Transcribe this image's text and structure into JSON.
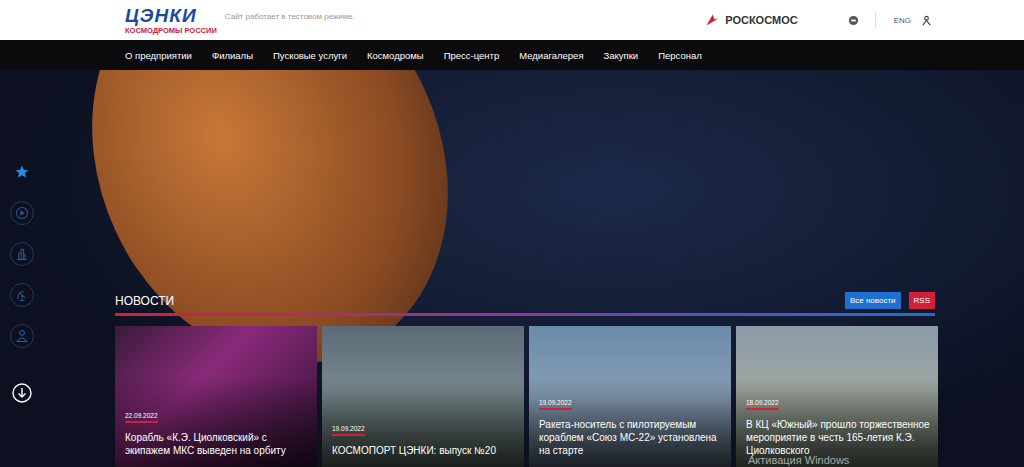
{
  "header": {
    "logo_title": "ЦЭНКИ",
    "logo_subtitle": "КОСМОДРОМЫ РОССИИ",
    "notice": "Сайт работает в тестовом режиме.",
    "partner": "РОСКОСМОС",
    "language": "ENG"
  },
  "nav": [
    "О предприятии",
    "Филиалы",
    "Пусковые услуги",
    "Космодромы",
    "Пресс-центр",
    "Медиагалерея",
    "Закупки",
    "Персонал"
  ],
  "side_menu": [
    {
      "selected": true
    },
    {
      "selected": false
    },
    {
      "selected": false
    },
    {
      "selected": false
    },
    {
      "selected": false
    }
  ],
  "news": {
    "title": "НОВОСТИ",
    "buttons": [
      {
        "label": "Все новости",
        "color": "#1e6fd0"
      },
      {
        "label": "RSS",
        "color": "#d0203a"
      }
    ],
    "items": [
      {
        "date": "22.09.2022",
        "title": "Корабль «К.Э. Циолковский» с экипажем МКС выведен на орбиту"
      },
      {
        "date": "19.09.2022",
        "title": "КОСМОПОРТ ЦЭНКИ: выпуск №20"
      },
      {
        "date": "19.09.2022",
        "title": "Ракета-носитель с пилотируемым кораблем «Союз МС-22» установлена на старте"
      },
      {
        "date": "18.09.2022",
        "title": "В КЦ «Южный» прошло торжественное мероприятие в честь 165-летия К.Э. Циолковского"
      }
    ]
  },
  "watermark": "Активация Windows"
}
